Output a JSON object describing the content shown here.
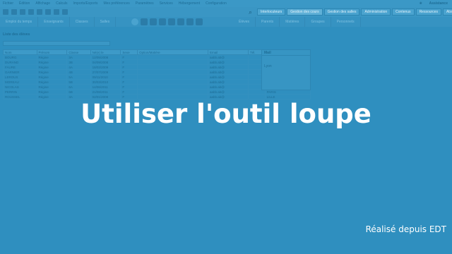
{
  "menu": [
    "Fichier",
    "Édition",
    "Affichage",
    "Calculs",
    "Imports/Exports",
    "Mes préférences",
    "Paramètres",
    "Services",
    "Hébergement",
    "Configuration"
  ],
  "assistance": "Assistance",
  "tabs": [
    "Interlocuteurs",
    "Gestion des cours",
    "Gestion des salles",
    "Administration",
    "Contenus",
    "Ressources",
    "Absences"
  ],
  "modes": [
    "Emploi du temps",
    "Enseignants",
    "Classes",
    "Salles",
    "Élèves",
    "Parents",
    "Matières",
    "Groupes",
    "Personnels"
  ],
  "list": {
    "title": "Liste des élèves",
    "columns": [
      "Nom",
      "Prénom",
      "Classe",
      "Né(e) le",
      "Sexe",
      "Option/Matière",
      "Email",
      "Tél.",
      "Ville"
    ],
    "rows": [
      [
        "BOURG",
        "Régine",
        "3A",
        "12/05/2008",
        "F",
        "",
        "aabb.ab@",
        "",
        "MONTPELLIER"
      ],
      [
        "DURAND",
        "Régine",
        "3B",
        "04/09/2008",
        "F",
        "",
        "aabb.ab@",
        "",
        "MONTPELLIER"
      ],
      [
        "FAURE",
        "Régine",
        "4A",
        "18/02/2009",
        "F",
        "",
        "aabb.ab@",
        "",
        "LYON"
      ],
      [
        "GARNIER",
        "Régine",
        "4B",
        "27/07/2009",
        "F",
        "",
        "aabb.ab@",
        "",
        "LYON"
      ],
      [
        "LEROUX",
        "Régine",
        "5A",
        "09/11/2010",
        "F",
        "",
        "aabb.ab@",
        "",
        "NANTES"
      ],
      [
        "MOREAU",
        "Régine",
        "5B",
        "30/03/2010",
        "F",
        "",
        "aabb.ab@",
        "",
        "NANTES"
      ],
      [
        "NICOLAS",
        "Régine",
        "6A",
        "14/06/2011",
        "F",
        "",
        "aabb.ab@",
        "",
        "PARIS"
      ],
      [
        "PERRIN",
        "Régine",
        "6B",
        "21/08/2011",
        "F",
        "",
        "aabb.ab@",
        "",
        "PARIS"
      ],
      [
        "ROUSSEL",
        "Régine",
        "3A",
        "02/01/2008",
        "F",
        "",
        "aabb.ab@",
        "",
        "LILLE"
      ]
    ]
  },
  "side_panel": {
    "head": "Mail",
    "value": "Lyon"
  },
  "overlay": {
    "title": "Utiliser l'outil loupe",
    "credit": "Réalisé depuis EDT"
  }
}
